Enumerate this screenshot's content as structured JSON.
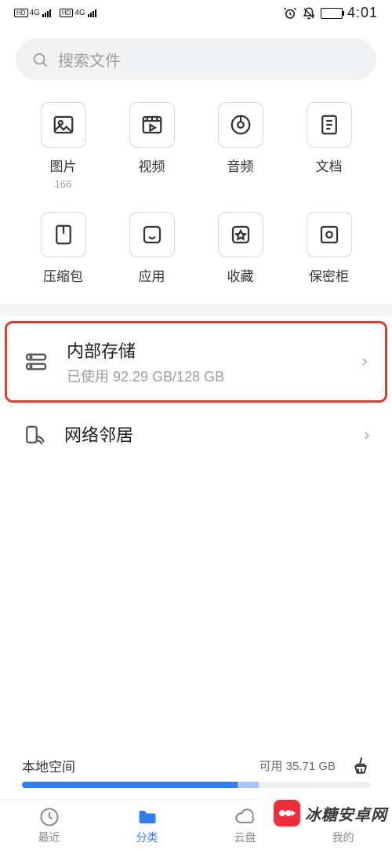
{
  "status_bar": {
    "hd_label_top": "HD",
    "signal_top": "4G",
    "hd_label_bot": "HD",
    "signal_bot": "4G",
    "time": "4:01"
  },
  "search": {
    "placeholder": "搜索文件"
  },
  "categories": [
    {
      "label": "图片",
      "count": "166"
    },
    {
      "label": "视频"
    },
    {
      "label": "音频"
    },
    {
      "label": "文档"
    },
    {
      "label": "压缩包"
    },
    {
      "label": "应用"
    },
    {
      "label": "收藏"
    },
    {
      "label": "保密柜"
    }
  ],
  "storage_row": {
    "title": "内部存储",
    "subtitle": "已使用 92.29 GB/128 GB"
  },
  "network_row": {
    "title": "网络邻居"
  },
  "local_space": {
    "label": "本地空间",
    "available": "可用 35.71 GB"
  },
  "nav": {
    "recent": "最近",
    "category": "分类",
    "cloud": "云盘",
    "me": "我的"
  },
  "watermark": "冰糖安卓网"
}
